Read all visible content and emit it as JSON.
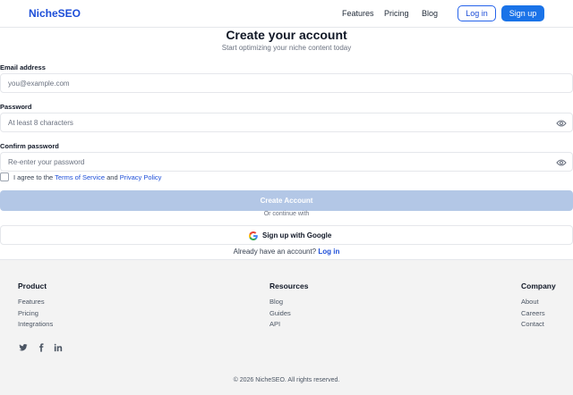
{
  "header": {
    "logo": "NicheSEO",
    "nav": [
      "Features",
      "Pricing",
      "Blog"
    ],
    "login": "Log in",
    "signup": "Sign up"
  },
  "form": {
    "title": "Create your account",
    "subtitle": "Start optimizing your niche content today",
    "email_label": "Email address",
    "email_placeholder": "you@example.com",
    "password_label": "Password",
    "password_placeholder": "At least 8 characters",
    "confirm_label": "Confirm password",
    "confirm_placeholder": "Re-enter your password",
    "agree_prefix": "I agree to the",
    "terms": "Terms of Service",
    "agree_and": "and",
    "privacy": "Privacy Policy",
    "submit": "Create Account",
    "or": "Or continue with",
    "google": "Sign up with Google",
    "have_account": "Already have an account?",
    "login_link": "Log in"
  },
  "footer": {
    "product": {
      "heading": "Product",
      "links": [
        "Features",
        "Pricing",
        "Integrations"
      ]
    },
    "resources": {
      "heading": "Resources",
      "links": [
        "Blog",
        "Guides",
        "API"
      ]
    },
    "company": {
      "heading": "Company",
      "links": [
        "About",
        "Careers",
        "Contact"
      ]
    },
    "social": [
      "twitter-icon",
      "facebook-icon",
      "linkedin-icon"
    ],
    "copyright": "© 2026 NicheSEO. All rights reserved."
  },
  "colors": {
    "brand": "#1d4ed8",
    "primary_button": "#1a73e8",
    "disabled_button": "#b3c7e6",
    "footer_bg": "#f3f3f3"
  }
}
